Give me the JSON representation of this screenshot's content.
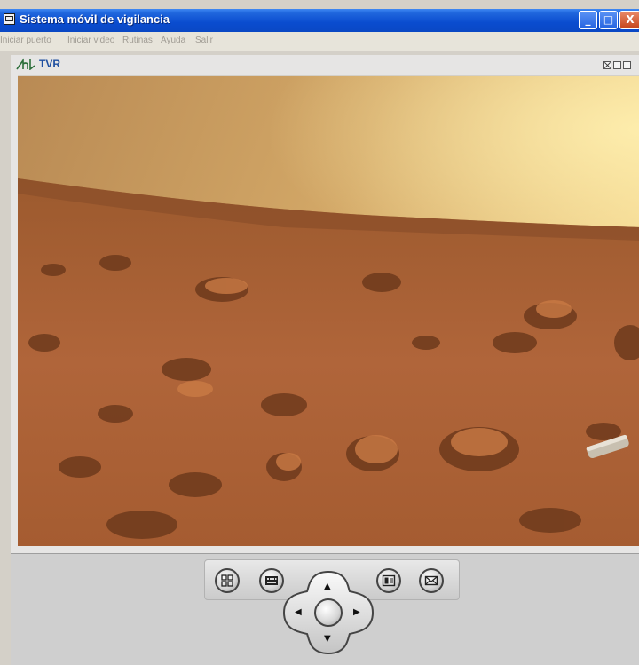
{
  "window": {
    "title": "Sistema móvil de vigilancia",
    "minimize": "_",
    "maximize": "□",
    "close": "X"
  },
  "menu": [
    {
      "label": "Iniciar puerto"
    },
    {
      "label": "Iniciar video"
    },
    {
      "label": "Rutinas"
    },
    {
      "label": "Ayuda"
    },
    {
      "label": "Salir"
    }
  ],
  "viewer": {
    "brand": "TVR",
    "logo_icon": "ht-logo-icon"
  },
  "controls": {
    "buttons": [
      {
        "icon": "windows-icon"
      },
      {
        "icon": "keyboard-icon"
      },
      {
        "icon": "video-panel-icon"
      },
      {
        "icon": "mail-icon"
      }
    ],
    "dpad": {
      "up": "▲",
      "down": "▼",
      "left": "◀",
      "right": "▶"
    }
  },
  "colors": {
    "title_bar": "#0a4ccf",
    "brand_text": "#1f4fa0",
    "menu_text_disabled": "#a09c94"
  }
}
